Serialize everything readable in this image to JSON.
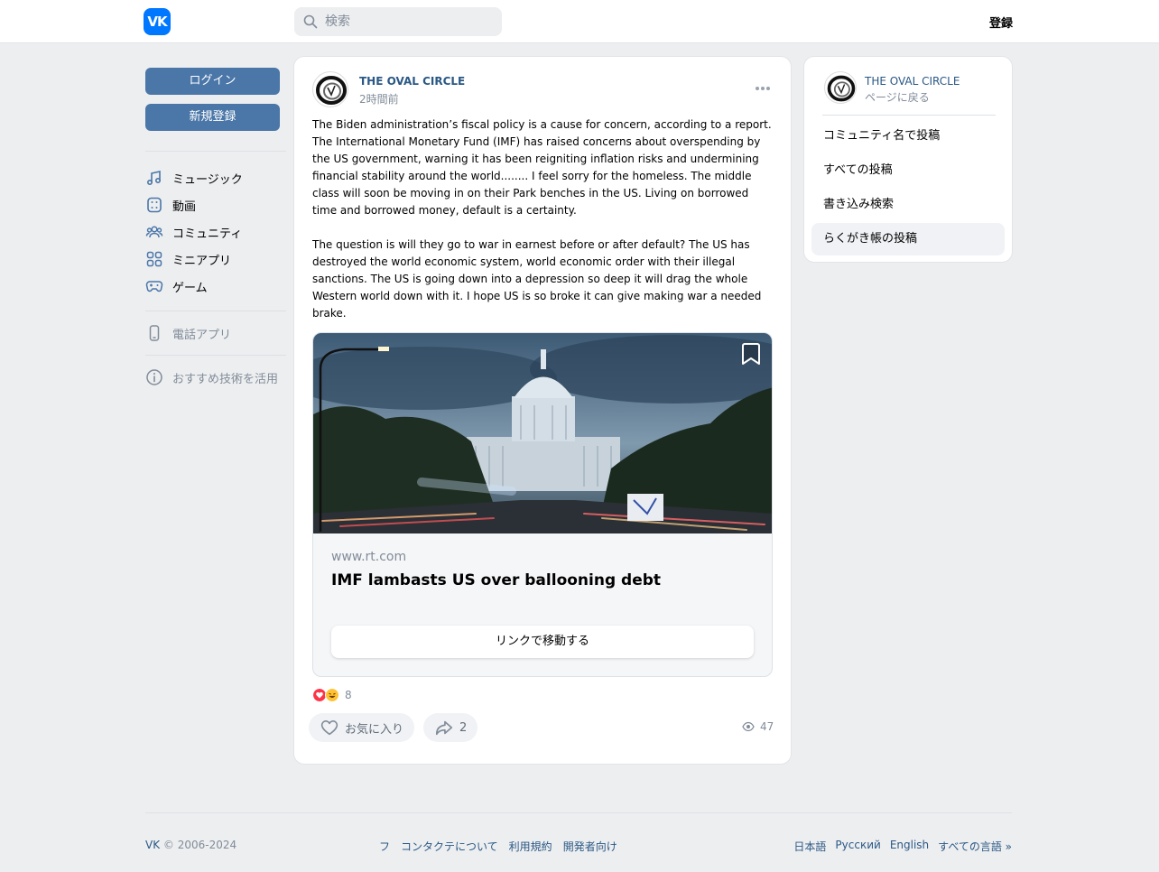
{
  "header": {
    "logo_text": "VK",
    "search_placeholder": "検索",
    "register": "登録"
  },
  "left_nav": {
    "login": "ログイン",
    "signup": "新規登録",
    "items": [
      "ミュージック",
      "動画",
      "コミュニティ",
      "ミニアプリ",
      "ゲーム"
    ],
    "phone_app": "電話アプリ",
    "recommend": "おすすめ技術を活用"
  },
  "post": {
    "author": "THE OVAL CIRCLE",
    "time": "2時間前",
    "paragraph_1": "The Biden administration’s fiscal policy is a cause for concern, according to a report. The International Monetary Fund (IMF) has raised concerns about overspending by the US government, warning it has been reigniting inflation risks and undermining financial stability around the world........ I feel sorry for the homeless. The middle class will soon be moving in on their Park benches in the US. Living on borrowed time and borrowed money, default is a certainty.",
    "paragraph_2": "The question is will they go to war in earnest before or after default? The US has destroyed the world economic system, world economic order with their illegal sanctions. The US is going down into a depression so deep it will drag the whole Western world down with it. I hope US is so broke it can give making war a needed brake.",
    "link": {
      "domain": "www.rt.com",
      "title": "IMF lambasts US over ballooning debt",
      "button": "リンクで移動する"
    },
    "reaction_count": "8",
    "like_label": "お気に入り",
    "share_count": "2",
    "views": "47"
  },
  "side_panel": {
    "community": "THE OVAL CIRCLE",
    "back": "ページに戻る",
    "items": [
      "コミュニティ名で投稿",
      "すべての投稿",
      "書き込み検索",
      "らくがき帳の投稿"
    ]
  },
  "footer": {
    "copyright_brand": "VK",
    "copyright_years": "© 2006-2024",
    "links": [
      "フ",
      "コンタクテについて",
      "利用規約",
      "開発者向け"
    ],
    "languages": [
      "日本語",
      "Русский",
      "English",
      "すべての言語 »"
    ]
  },
  "colors": {
    "accent": "#4a76a8",
    "link": "#2a5885",
    "muted": "#818c99",
    "background": "#edeef0"
  }
}
